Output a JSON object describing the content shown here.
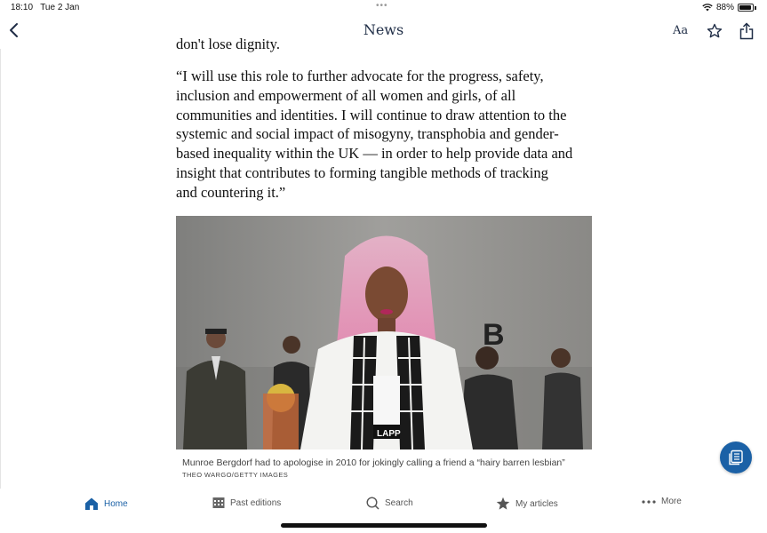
{
  "status": {
    "time": "18:10",
    "date": "Tue 2 Jan",
    "battery": "88%"
  },
  "nav": {
    "title": "News",
    "text_size_label": "Aa"
  },
  "article": {
    "partial_line": "don't lose dignity.",
    "quote_lines": [
      "“I will use this role to further advocate for the progress, safety,",
      "inclusion and empowerment of all women and girls, of all",
      "communities and identities. I will continue to draw attention to the",
      "systemic and social impact of misogyny, transphobia and gender-",
      "based inequality within the UK — in order to help provide data and",
      "insight that contributes to forming tangible methods of tracking",
      "and countering it.”"
    ],
    "photo": {
      "jacket_text": "LAPP",
      "backdrop_letter": "B"
    },
    "caption": "Munroe Bergdorf had to apologise in 2010 for jokingly calling a friend a “hairy barren lesbian”",
    "credit": "THEO WARGO/GETTY IMAGES"
  },
  "tabs": {
    "home": "Home",
    "past_editions": "Past editions",
    "search": "Search",
    "my_articles": "My articles",
    "more": "More"
  },
  "colors": {
    "accent": "#1b61a6",
    "nav_text": "#1f2d46"
  }
}
